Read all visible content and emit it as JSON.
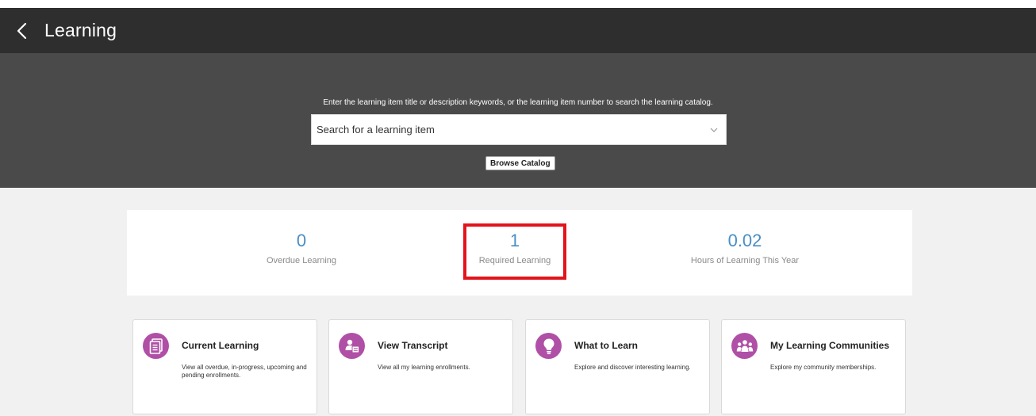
{
  "header": {
    "title": "Learning",
    "back_icon": "chevron-left-icon"
  },
  "search": {
    "hint": "Enter the learning item title or description keywords, or the learning item number to search the learning catalog.",
    "placeholder": "Search for a learning item",
    "dropdown_icon": "chevron-down-icon",
    "browse_label": "Browse Catalog"
  },
  "stats": [
    {
      "value": "0",
      "label": "Overdue Learning"
    },
    {
      "value": "1",
      "label": "Required Learning",
      "highlighted": true
    },
    {
      "value": "0.02",
      "label": "Hours of Learning This Year"
    }
  ],
  "cards": [
    {
      "title": "Current Learning",
      "description": "View all overdue, in-progress, upcoming and pending enrollments.",
      "icon": "document-icon"
    },
    {
      "title": "View Transcript",
      "description": "View all my learning enrollments.",
      "icon": "transcript-icon"
    },
    {
      "title": "What to Learn",
      "description": "Explore and discover interesting learning.",
      "icon": "lightbulb-icon"
    },
    {
      "title": "My Learning Communities",
      "description": "Explore my community memberships.",
      "icon": "community-icon"
    }
  ],
  "colors": {
    "header_bg": "#2e2e2e",
    "search_band_bg": "#4a4a4a",
    "content_bg": "#f1f1f1",
    "stat_value": "#4a8ec4",
    "card_icon_bg": "#b04fa6",
    "highlight": "#e2141c"
  }
}
